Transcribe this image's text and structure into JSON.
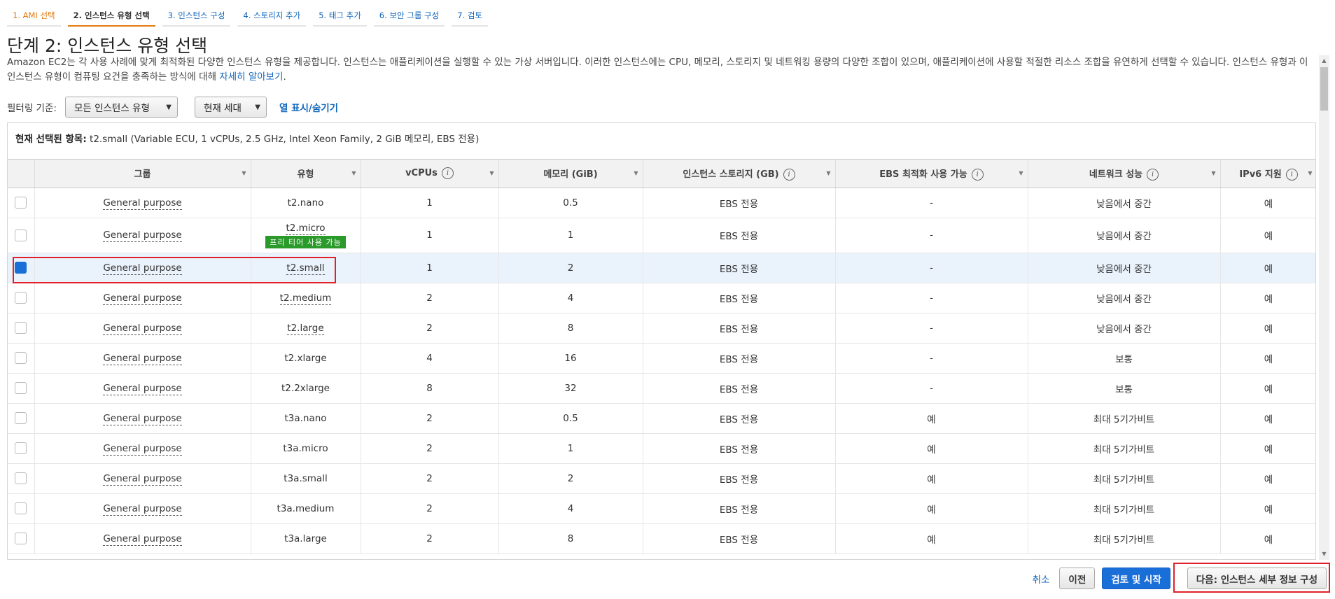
{
  "steps": [
    {
      "label": "1. AMI 선택",
      "state": "done"
    },
    {
      "label": "2. 인스턴스 유형 선택",
      "state": "active"
    },
    {
      "label": "3. 인스턴스 구성",
      "state": "todo"
    },
    {
      "label": "4. 스토리지 추가",
      "state": "todo"
    },
    {
      "label": "5. 태그 추가",
      "state": "todo"
    },
    {
      "label": "6. 보안 그룹 구성",
      "state": "todo"
    },
    {
      "label": "7. 검토",
      "state": "todo"
    }
  ],
  "page": {
    "title": "단계 2: 인스턴스 유형 선택",
    "description": "Amazon EC2는 각 사용 사례에 맞게 최적화된 다양한 인스턴스 유형을 제공합니다. 인스턴스는 애플리케이션을 실행할 수 있는 가상 서버입니다. 이러한 인스턴스에는 CPU, 메모리, 스토리지 및 네트워킹 용량의 다양한 조합이 있으며, 애플리케이션에 사용할 적절한 리소스 조합을 유연하게 선택할 수 있습니다. 인스턴스 유형과 이 인스턴스 유형이 컴퓨팅 요건을 충족하는 방식에 대해 ",
    "learn_more": "자세히 알아보기",
    "learn_more_suffix": "."
  },
  "filter": {
    "label": "필터링 기준:",
    "family": "모든 인스턴스 유형",
    "generation": "현재 세대",
    "columns_link": "열 표시/숨기기"
  },
  "selection": {
    "label": "현재 선택된 항목:",
    "value": "t2.small (Variable ECU, 1 vCPUs, 2.5 GHz, Intel Xeon Family, 2 GiB 메모리, EBS 전용)"
  },
  "table": {
    "headers": {
      "group": "그룹",
      "type": "유형",
      "vcpus": "vCPUs",
      "memory": "메모리 (GiB)",
      "storage": "인스턴스 스토리지 (GB)",
      "ebs": "EBS 최적화 사용 가능",
      "network": "네트워크 성능",
      "ipv6": "IPv6 지원"
    },
    "info_glyph": "i",
    "free_tier_badge": "프리 티어 사용 가능",
    "rows": [
      {
        "group": "General purpose",
        "type": "t2.nano",
        "vcpus": "1",
        "memory": "0.5",
        "storage": "EBS 전용",
        "ebs": "-",
        "network": "낮음에서 중간",
        "ipv6": "예"
      },
      {
        "group": "General purpose",
        "type": "t2.micro",
        "vcpus": "1",
        "memory": "1",
        "storage": "EBS 전용",
        "ebs": "-",
        "network": "낮음에서 중간",
        "ipv6": "예"
      },
      {
        "group": "General purpose",
        "type": "t2.small",
        "vcpus": "1",
        "memory": "2",
        "storage": "EBS 전용",
        "ebs": "-",
        "network": "낮음에서 중간",
        "ipv6": "예"
      },
      {
        "group": "General purpose",
        "type": "t2.medium",
        "vcpus": "2",
        "memory": "4",
        "storage": "EBS 전용",
        "ebs": "-",
        "network": "낮음에서 중간",
        "ipv6": "예"
      },
      {
        "group": "General purpose",
        "type": "t2.large",
        "vcpus": "2",
        "memory": "8",
        "storage": "EBS 전용",
        "ebs": "-",
        "network": "낮음에서 중간",
        "ipv6": "예"
      },
      {
        "group": "General purpose",
        "type": "t2.xlarge",
        "vcpus": "4",
        "memory": "16",
        "storage": "EBS 전용",
        "ebs": "-",
        "network": "보통",
        "ipv6": "예"
      },
      {
        "group": "General purpose",
        "type": "t2.2xlarge",
        "vcpus": "8",
        "memory": "32",
        "storage": "EBS 전용",
        "ebs": "-",
        "network": "보통",
        "ipv6": "예"
      },
      {
        "group": "General purpose",
        "type": "t3a.nano",
        "vcpus": "2",
        "memory": "0.5",
        "storage": "EBS 전용",
        "ebs": "예",
        "network": "최대 5기가비트",
        "ipv6": "예"
      },
      {
        "group": "General purpose",
        "type": "t3a.micro",
        "vcpus": "2",
        "memory": "1",
        "storage": "EBS 전용",
        "ebs": "예",
        "network": "최대 5기가비트",
        "ipv6": "예"
      },
      {
        "group": "General purpose",
        "type": "t3a.small",
        "vcpus": "2",
        "memory": "2",
        "storage": "EBS 전용",
        "ebs": "예",
        "network": "최대 5기가비트",
        "ipv6": "예"
      },
      {
        "group": "General purpose",
        "type": "t3a.medium",
        "vcpus": "2",
        "memory": "4",
        "storage": "EBS 전용",
        "ebs": "예",
        "network": "최대 5기가비트",
        "ipv6": "예"
      },
      {
        "group": "General purpose",
        "type": "t3a.large",
        "vcpus": "2",
        "memory": "8",
        "storage": "EBS 전용",
        "ebs": "예",
        "network": "최대 5기가비트",
        "ipv6": "예"
      }
    ]
  },
  "footer": {
    "cancel": "취소",
    "previous": "이전",
    "review_launch": "검토 및 시작",
    "next": "다음: 인스턴스 세부 정보 구성"
  },
  "colors": {
    "accent_orange": "#e47911",
    "link_blue": "#1166bb",
    "primary_blue": "#1a6ed8",
    "free_tier_green": "#2a9a2a",
    "highlight_red": "#e0202a"
  }
}
